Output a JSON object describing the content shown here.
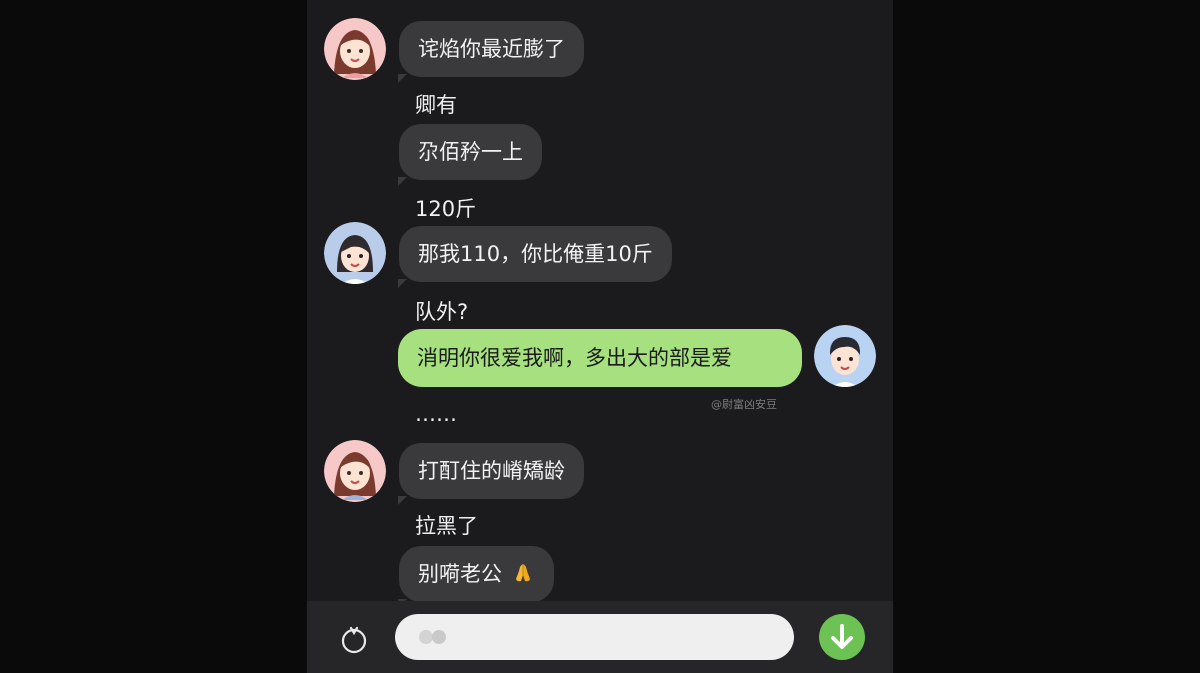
{
  "chat": {
    "messages": [
      {
        "text": "诧焰你最近膨了",
        "sender": "girl"
      },
      {
        "text": "卿有",
        "sender": "girl"
      },
      {
        "text": "尕佰矜一上",
        "sender": "girl"
      },
      {
        "text": "120斤",
        "sender": "girl"
      },
      {
        "text": "那我110，你比俺重10斤",
        "sender": "girl"
      },
      {
        "text": "队外?",
        "sender": "girl"
      },
      {
        "text": "消明你很爱我啊，多出大的部是爱",
        "sender": "me"
      },
      {
        "text": "……",
        "sender": "me"
      },
      {
        "text": "打酊住的嵴矯龄",
        "sender": "girl"
      },
      {
        "text": "拉黑了",
        "sender": "girl"
      },
      {
        "text": "别嗬老公",
        "sender": "me",
        "emoji": "folded-hands-emoji"
      }
    ],
    "watermark": "@尉富凶安豆"
  },
  "input_bar": {
    "placeholder": "",
    "voice_icon": "voice-icon",
    "send_icon": "arrow-down-icon"
  },
  "colors": {
    "background": "#0a0a0b",
    "chat_background": "#1b1b1d",
    "incoming_bubble": "#3a3a3d",
    "outgoing_bubble": "#a6e07f",
    "send_button": "#6cc354",
    "input_field": "#efefef"
  }
}
